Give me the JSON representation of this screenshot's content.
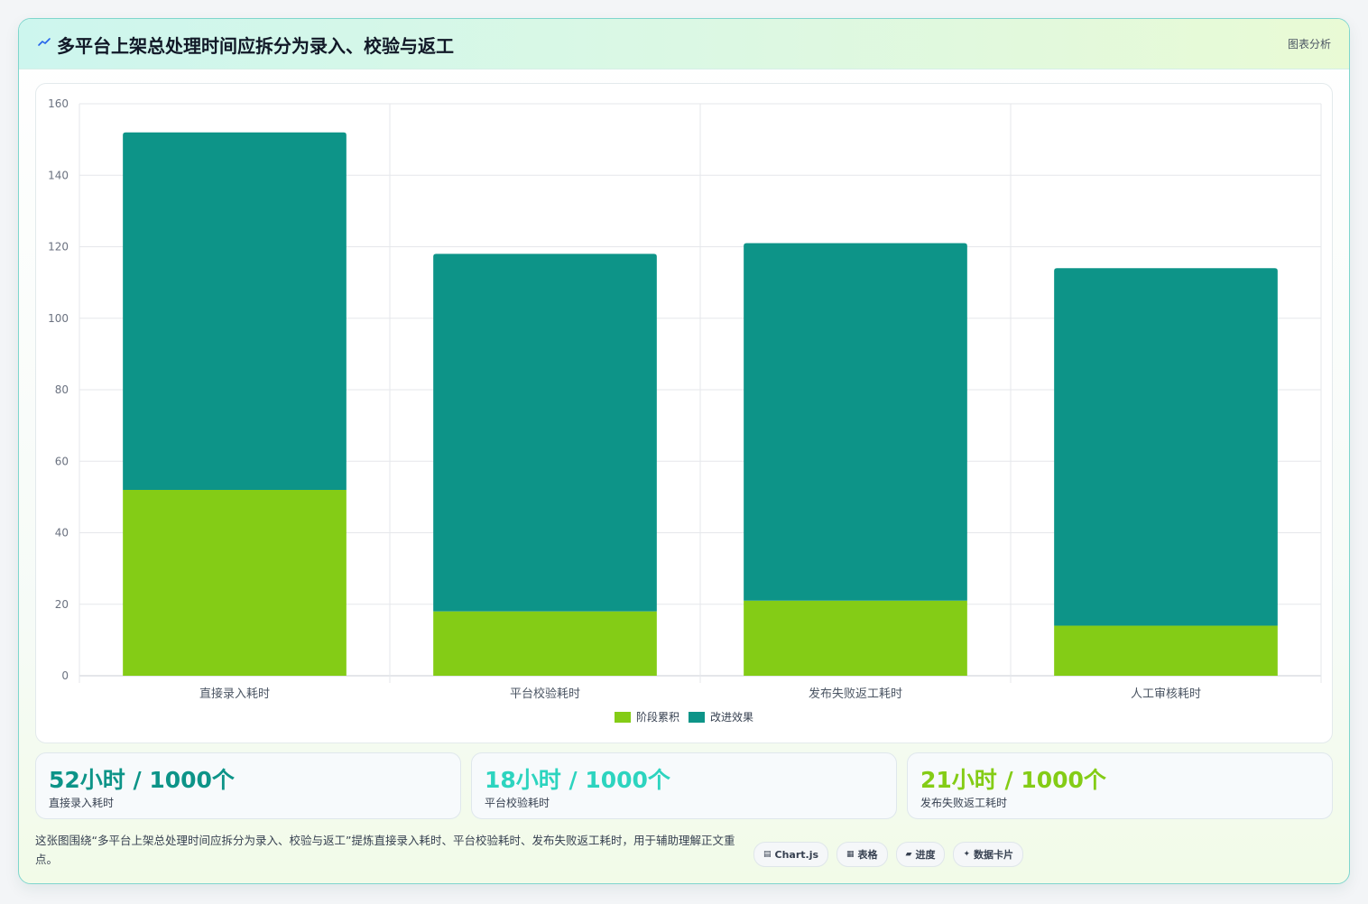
{
  "header": {
    "title": "多平台上架总处理时间应拆分为录入、校验与返工",
    "tag": "图表分析"
  },
  "chart_data": {
    "type": "bar",
    "stacked": true,
    "categories": [
      "直接录入耗时",
      "平台校验耗时",
      "发布失败返工耗时",
      "人工审核耗时"
    ],
    "series": [
      {
        "name": "阶段累积",
        "color": "#84cc16",
        "values": [
          52,
          18,
          21,
          14
        ]
      },
      {
        "name": "改进效果",
        "color": "#0d9488",
        "values": [
          100,
          100,
          100,
          100
        ]
      }
    ],
    "ylim": [
      0,
      160
    ],
    "yticks": [
      0,
      20,
      40,
      60,
      80,
      100,
      120,
      140,
      160
    ],
    "grid": true,
    "legend_position": "bottom"
  },
  "stats": [
    {
      "value": "52小时 / 1000个",
      "label": "直接录入耗时",
      "color": "#0d9488"
    },
    {
      "value": "18小时 / 1000个",
      "label": "平台校验耗时",
      "color": "#2dd4bf"
    },
    {
      "value": "21小时 / 1000个",
      "label": "发布失败返工耗时",
      "color": "#84cc16"
    }
  ],
  "note": "这张图围绕“多平台上架总处理时间应拆分为录入、校验与返工”提炼直接录入耗时、平台校验耗时、发布失败返工耗时，用于辅助理解正文重点。",
  "chips": [
    {
      "icon": "▤",
      "label": "Chart.js",
      "icon_name": "chart-icon"
    },
    {
      "icon": "▦",
      "label": "表格",
      "icon_name": "table-icon"
    },
    {
      "icon": "▰",
      "label": "进度",
      "icon_name": "progress-icon"
    },
    {
      "icon": "✦",
      "label": "数据卡片",
      "icon_name": "sparkle-icon"
    }
  ]
}
